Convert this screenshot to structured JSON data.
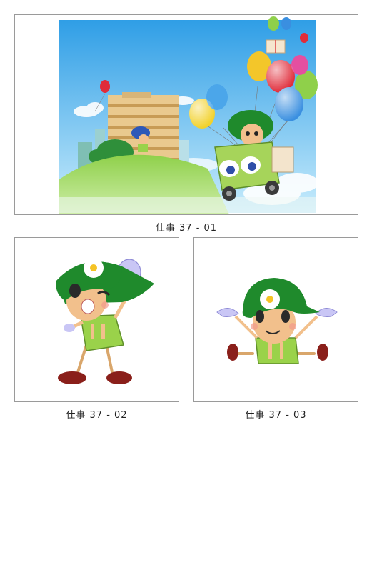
{
  "figures": [
    {
      "caption": "仕事 37 - 01",
      "scene": "city-hill-balloons-truck"
    },
    {
      "caption": "仕事 37 - 02",
      "scene": "character-winking-thumbs-up"
    },
    {
      "caption": "仕事 37 - 03",
      "scene": "character-arms-open"
    }
  ],
  "colors": {
    "sky_top": "#3aa6e8",
    "sky_bottom": "#bfe6fb",
    "hill": "#7ec440",
    "cap_green": "#1f8a2c",
    "vest_green": "#9ad24a",
    "skin": "#f2c08c",
    "glove": "#c9c6f5",
    "shoe": "#8a1f1a",
    "truck": "#a6d45a"
  }
}
